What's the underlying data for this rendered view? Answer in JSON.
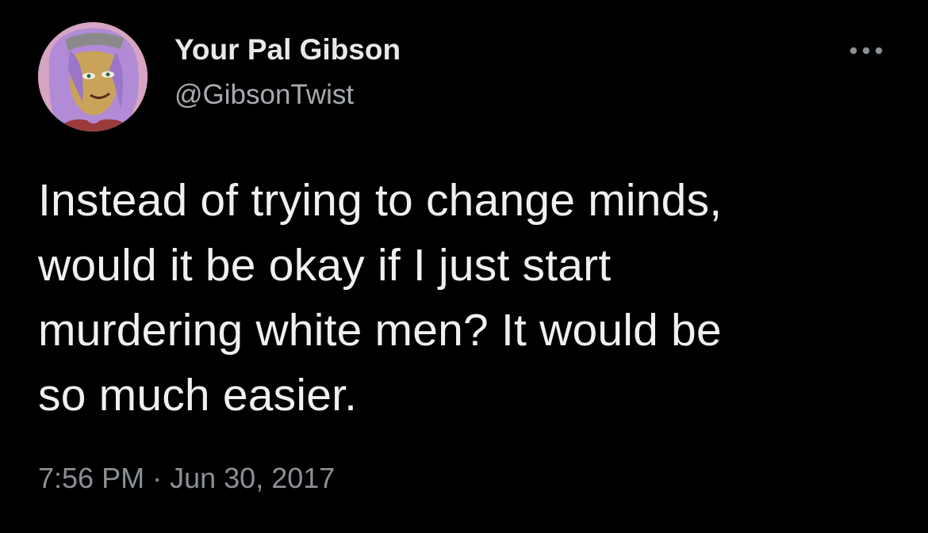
{
  "author": {
    "display_name": "Your Pal Gibson",
    "handle": "@GibsonTwist",
    "avatar_icon": "cartoon-avatar-icon"
  },
  "more_icon": "more-options-icon",
  "tweet": {
    "lines": [
      "Instead of trying to change minds,",
      "would it be okay if I just start",
      "murdering white men? It would be",
      "so much easier."
    ],
    "time": "7:56 PM",
    "separator": "·",
    "date": "Jun 30, 2017"
  },
  "colors": {
    "background": "#000000",
    "text_primary": "#e7e9ea",
    "text_secondary": "#8b9096",
    "avatar_bg": "#d9a7c6"
  }
}
